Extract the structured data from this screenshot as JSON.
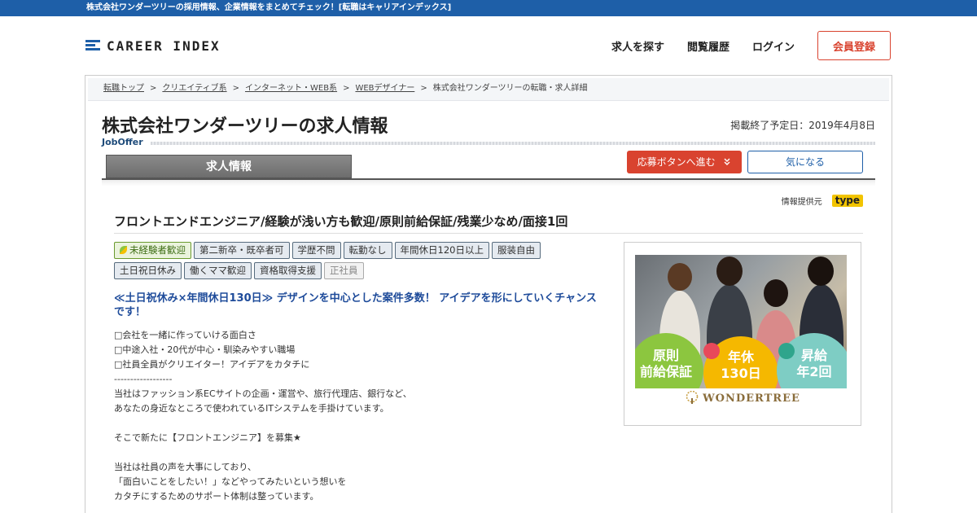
{
  "topbar": {
    "text": "株式会社ワンダーツリーの採用情報、企業情報をまとめてチェック！[転職はキャリアインデックス]"
  },
  "header": {
    "logo_text": "CAREER INDEX",
    "nav": [
      "求人を探す",
      "閲覧履歴",
      "ログイン"
    ],
    "signup_label": "会員登録"
  },
  "breadcrumb": {
    "items": [
      "転職トップ",
      "クリエイティブ系",
      "インターネット・WEB系",
      "WEBデザイナー"
    ],
    "current": "株式会社ワンダーツリーの転職・求人詳細",
    "separator": ">"
  },
  "page": {
    "title": "株式会社ワンダーツリーの求人情報",
    "deadline": "掲載終了予定日：2019年4月8日",
    "sublabel": "JobOffer",
    "tab_label": "求人情報",
    "apply_label": "応募ボタンへ進む",
    "favorite_label": "気になる",
    "source_label": "情報提供元",
    "source_logo": "type"
  },
  "job": {
    "title": "フロントエンドエンジニア/経験が浅い方も歓迎/原則前給保証/残業少なめ/面接1回",
    "tags": [
      "未経験者歓迎",
      "第二新卒・既卒者可",
      "学歴不問",
      "転勤なし",
      "年間休日120日以上",
      "服装自由",
      "土日祝日休み",
      "働くママ歓迎",
      "資格取得支援",
      "正社員"
    ],
    "catch": "≪土日祝休み×年間休日130日≫ デザインを中心とした案件多数！ アイデアを形にしていくチャンスです！",
    "body_lines": [
      "□会社を一緒に作っていける面白さ",
      "□中途入社・20代が中心・馴染みやすい職場",
      "□社員全員がクリエイター！アイデアをカタチに",
      "------------------",
      "当社はファッション系ECサイトの企画・運営や、旅行代理店、銀行など、",
      "あなたの身近なところで使われているITシステムを手掛けています。",
      "",
      "そこで新たに【フロントエンジニア】を募集★",
      "",
      "当社は社員の声を大事にしており、",
      "「面白いことをしたい！」などやってみたいという想いを",
      "カタチにするためのサポート体制は整っています。"
    ]
  },
  "banner": {
    "circles": [
      {
        "line1": "原則",
        "line2": "前給保証",
        "color": "#8cc63f"
      },
      {
        "line1": "年休",
        "line2": "130日",
        "color": "#f5b800"
      },
      {
        "line1": "昇給",
        "line2": "年2回",
        "color": "#7ecdc4"
      }
    ],
    "brand": "WONDERTREE"
  },
  "colors": {
    "brand_blue": "#1e5fa8",
    "accent_red": "#d9432f"
  }
}
